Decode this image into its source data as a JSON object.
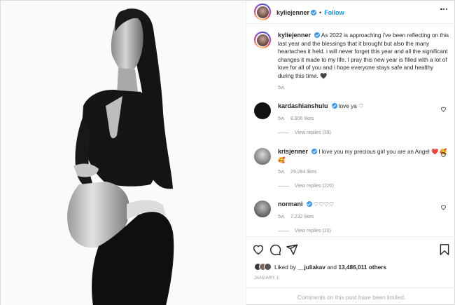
{
  "post": {
    "author": "kyliejenner",
    "follow_label": "Follow",
    "separator": "•"
  },
  "caption": {
    "user": "kyliejenner",
    "text": "As 2022 is approaching i've been reflecting on this last year and the blessings that it brought but also the many heartaches it held. i will never forget this year and all the significant changes it made to my life. I pray this new year is filled with a lot of love for all of you and i hope everyone stays safe and healthy during this time. 🖤",
    "age": "5w"
  },
  "comments": [
    {
      "user": "kardashianshulu",
      "text": "love ya ♡",
      "age": "5w",
      "likes": "8.906 likes",
      "replies": "View replies (39)",
      "verified": true
    },
    {
      "user": "krisjenner",
      "text": "I love you my precious girl you are an Angel ❤️ 🥰🥰",
      "age": "5w",
      "likes": "29.284 likes",
      "replies": "View replies (220)",
      "verified": true
    },
    {
      "user": "normani",
      "text": "♡♡♡♡",
      "age": "5w",
      "likes": "7.232 likes",
      "replies": "View replies (20)",
      "verified": true
    }
  ],
  "likes": {
    "prefix": "Liked by",
    "user": "__juliakav",
    "conjunction": "and",
    "count": "13,486,011 others"
  },
  "date": "JANUARY 1",
  "limited_notice": "Comments on this post have been limited.",
  "icons": [
    "heart-icon",
    "comment-icon",
    "share-icon",
    "bookmark-icon",
    "more-options-icon",
    "verified-icon"
  ],
  "colors": {
    "accent": "#0095f6",
    "verified": "#3897f0",
    "muted": "#8e8e8e",
    "text": "#262626"
  }
}
